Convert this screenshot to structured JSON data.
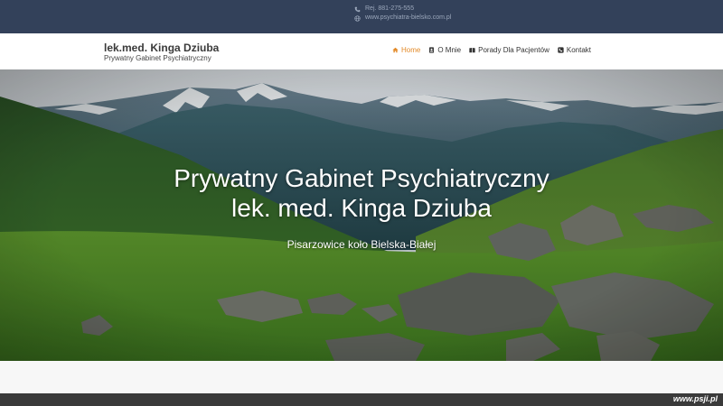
{
  "topbar": {
    "phone": "Rej. 881-275-555",
    "website": "www.psychiatra-bielsko.com.pl"
  },
  "brand": {
    "title": "lek.med. Kinga Dziuba",
    "subtitle": "Prywatny Gabinet Psychiatryczny"
  },
  "nav": {
    "items": [
      {
        "label": "Home",
        "icon": "home-icon"
      },
      {
        "label": "O Mnie",
        "icon": "person-badge-icon"
      },
      {
        "label": "Porady Dla Pacjentów",
        "icon": "book-icon"
      },
      {
        "label": "Kontakt",
        "icon": "phone-icon"
      }
    ],
    "active": "Home"
  },
  "hero": {
    "title_line1": "Prywatny Gabinet Psychiatryczny",
    "title_line2": "lek. med. Kinga Dziuba",
    "subtitle": "Pisarzowice koło Bielska-Białej"
  },
  "watermark": "www.psji.pl",
  "colors": {
    "topbar": "#33415a",
    "accent": "#e38b2a",
    "footer": "#3a3a3a"
  }
}
